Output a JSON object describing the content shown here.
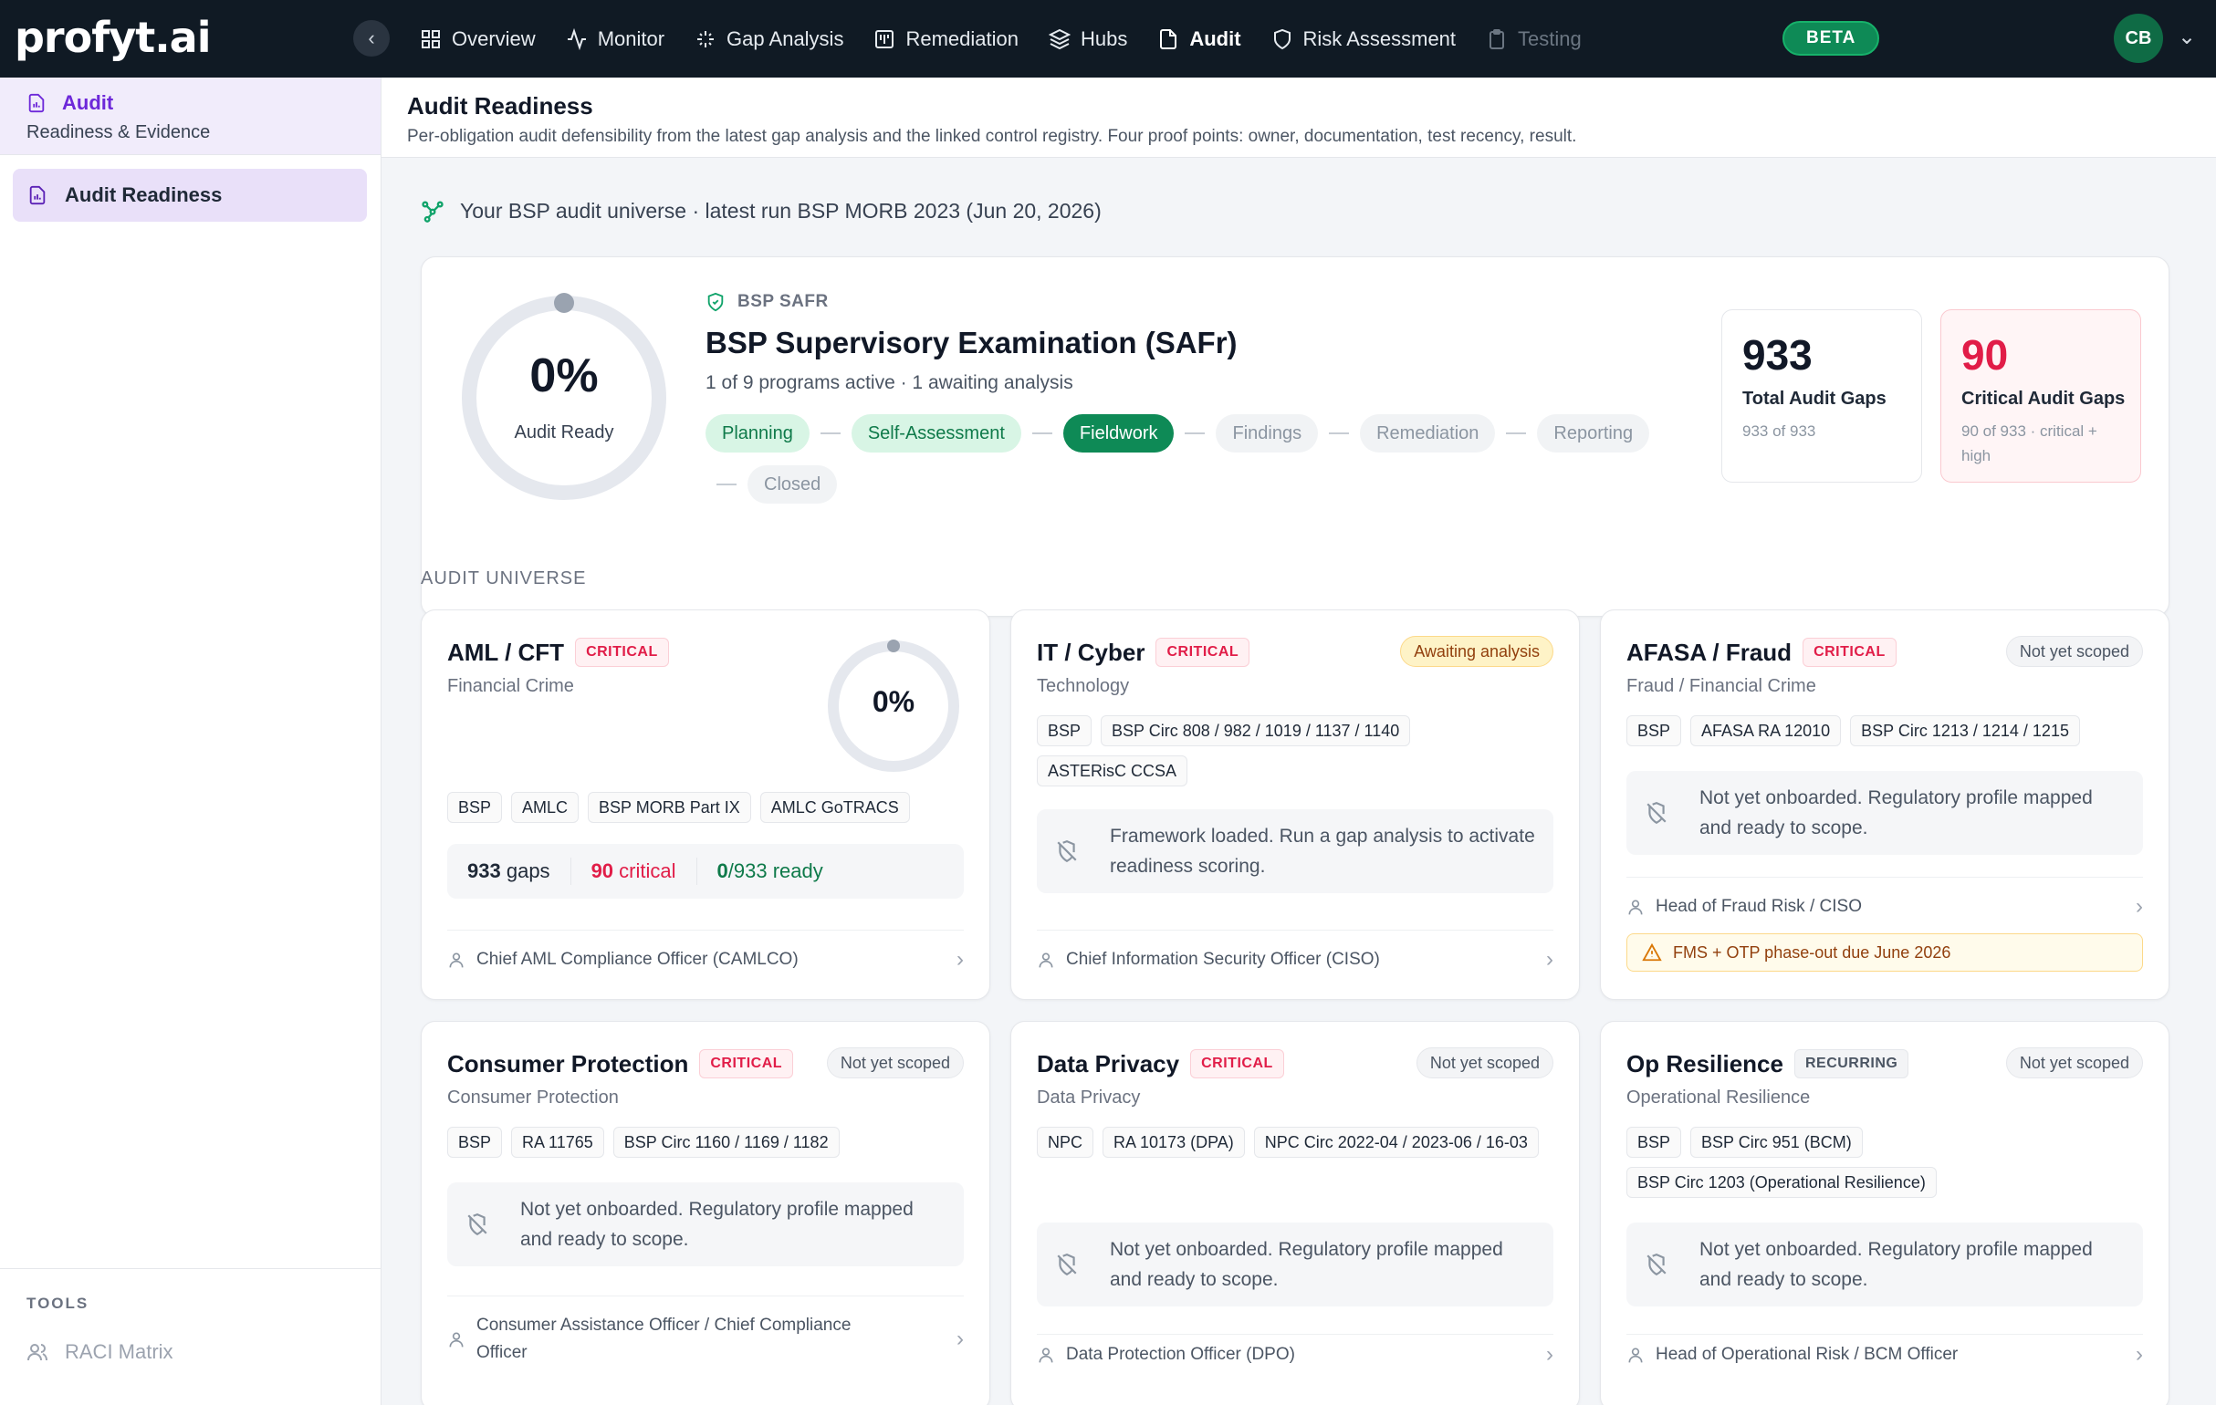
{
  "brand": {
    "logo": "profyt.ai"
  },
  "nav": {
    "items": [
      {
        "label": "Overview",
        "icon": "grid-icon"
      },
      {
        "label": "Monitor",
        "icon": "activity-icon"
      },
      {
        "label": "Gap Analysis",
        "icon": "sparkle-icon"
      },
      {
        "label": "Remediation",
        "icon": "board-icon"
      },
      {
        "label": "Hubs",
        "icon": "layers-icon"
      },
      {
        "label": "Audit",
        "icon": "file-icon",
        "active": true
      },
      {
        "label": "Risk Assessment",
        "icon": "shield-icon"
      },
      {
        "label": "Testing",
        "icon": "clipboard-icon",
        "disabled": true
      }
    ],
    "beta": "BETA",
    "avatar": "CB"
  },
  "sidebar": {
    "title": "Audit",
    "subtitle": "Readiness & Evidence",
    "active_item": "Audit Readiness",
    "tools_label": "TOOLS",
    "tools_item": "RACI Matrix"
  },
  "page": {
    "title": "Audit Readiness",
    "subtitle": "Per-obligation audit defensibility from the latest gap analysis and the linked control registry. Four proof points: owner, documentation, test recency, result.",
    "universe_line": "Your BSP audit universe · latest run BSP MORB 2023 (Jun 20, 2026)"
  },
  "hero": {
    "ready_pct": "0%",
    "ready_value": 0,
    "ready_label": "Audit Ready",
    "tag": "BSP SAFR",
    "title": "BSP Supervisory Examination (SAFr)",
    "subtitle": "1 of 9 programs active · 1 awaiting analysis",
    "stages": {
      "planning": "Planning",
      "self_assessment": "Self-Assessment",
      "fieldwork": "Fieldwork",
      "findings": "Findings",
      "remediation": "Remediation",
      "reporting": "Reporting",
      "closed": "Closed"
    },
    "total": {
      "value": "933",
      "label": "Total Audit Gaps",
      "sub": "933 of 933"
    },
    "critical": {
      "value": "90",
      "label": "Critical Audit Gaps",
      "sub": "90 of 933 · critical + high"
    }
  },
  "section_label": "AUDIT UNIVERSE",
  "cards": {
    "aml": {
      "title": "AML / CFT",
      "badge": "CRITICAL",
      "category": "Financial Crime",
      "ready_pct": "0%",
      "ready_value": 0,
      "tags": [
        "BSP",
        "AMLC",
        "BSP MORB Part IX",
        "AMLC GoTRACS"
      ],
      "gaps": "933",
      "gaps_label": "gaps",
      "critical": "90",
      "critical_label": "critical",
      "ready_num": "0",
      "ready_rest": "/933 ready",
      "owner": "Chief AML Compliance Officer (CAMLCO)"
    },
    "it": {
      "title": "IT / Cyber",
      "badge": "CRITICAL",
      "category": "Technology",
      "status": "Awaiting analysis",
      "tags": [
        "BSP",
        "BSP Circ 808 / 982 / 1019 / 1137 / 1140",
        "ASTERisC CCSA"
      ],
      "info": "Framework loaded. Run a gap analysis to activate readiness scoring.",
      "owner": "Chief Information Security Officer (CISO)"
    },
    "afasa": {
      "title": "AFASA / Fraud",
      "badge": "CRITICAL",
      "category": "Fraud / Financial Crime",
      "status": "Not yet scoped",
      "tags": [
        "BSP",
        "AFASA RA 12010",
        "BSP Circ 1213 / 1214 / 1215"
      ],
      "info": "Not yet onboarded. Regulatory profile mapped and ready to scope.",
      "owner": "Head of Fraud Risk / CISO",
      "warning": "FMS + OTP phase-out due June 2026"
    },
    "consumer": {
      "title": "Consumer Protection",
      "badge": "CRITICAL",
      "category": "Consumer Protection",
      "status": "Not yet scoped",
      "tags": [
        "BSP",
        "RA 11765",
        "BSP Circ 1160 / 1169 / 1182"
      ],
      "info": "Not yet onboarded. Regulatory profile mapped and ready to scope.",
      "owner": "Consumer Assistance Officer / Chief Compliance Officer"
    },
    "privacy": {
      "title": "Data Privacy",
      "badge": "CRITICAL",
      "category": "Data Privacy",
      "status": "Not yet scoped",
      "tags": [
        "NPC",
        "RA 10173 (DPA)",
        "NPC Circ 2022-04 / 2023-06 / 16-03"
      ],
      "info": "Not yet onboarded. Regulatory profile mapped and ready to scope.",
      "owner": "Data Protection Officer (DPO)"
    },
    "opres": {
      "title": "Op Resilience",
      "badge": "RECURRING",
      "category": "Operational Resilience",
      "status": "Not yet scoped",
      "tags": [
        "BSP",
        "BSP Circ 951 (BCM)",
        "BSP Circ 1203 (Operational Resilience)"
      ],
      "info": "Not yet onboarded. Regulatory profile mapped and ready to scope.",
      "owner": "Head of Operational Risk / BCM Officer"
    }
  },
  "colors": {
    "accent": "#0e8a56",
    "critical": "#e11d48",
    "brand_purple": "#6d28d9",
    "topbar": "#101a24"
  }
}
